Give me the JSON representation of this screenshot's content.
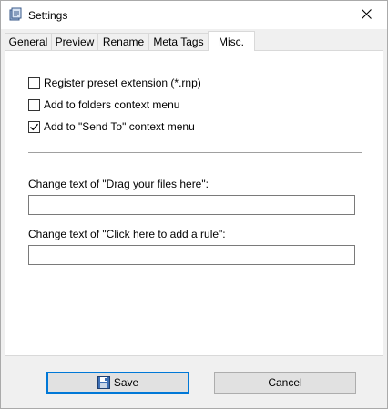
{
  "window": {
    "title": "Settings",
    "app_icon": "app-icon",
    "close_icon": "close-icon"
  },
  "tabs": [
    {
      "label": "General",
      "active": false
    },
    {
      "label": "Preview",
      "active": false
    },
    {
      "label": "Rename",
      "active": false
    },
    {
      "label": "Meta Tags",
      "active": false
    },
    {
      "label": "Misc.",
      "active": true
    }
  ],
  "options": [
    {
      "label": "Register preset extension (*.rnp)",
      "checked": false
    },
    {
      "label": "Add to folders context menu",
      "checked": false
    },
    {
      "label": "Add to \"Send To\" context menu",
      "checked": true
    }
  ],
  "fields": {
    "drag_label": "Change text of \"Drag your files here\":",
    "drag_value": "",
    "click_label": "Change text of \"Click here to add a rule\":",
    "click_value": ""
  },
  "buttons": {
    "save_label": "Save",
    "save_icon": "floppy-disk-icon",
    "cancel_label": "Cancel"
  },
  "colors": {
    "accent": "#0078d7"
  }
}
